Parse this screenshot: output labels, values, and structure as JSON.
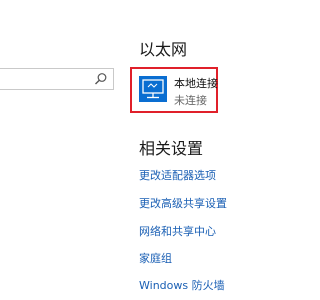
{
  "search": {
    "value": "",
    "icon": "search-icon"
  },
  "ethernet": {
    "heading": "以太网",
    "adapter": {
      "name": "本地连接",
      "status": "未连接",
      "icon": "network-adapter-icon",
      "icon_color": "#0a6ed1",
      "selection_color": "#e0202a"
    }
  },
  "related": {
    "heading": "相关设置",
    "link_color": "#1a5fb4",
    "links": [
      "更改适配器选项",
      "更改高级共享设置",
      "网络和共享中心",
      "家庭组",
      "Windows 防火墙"
    ]
  }
}
